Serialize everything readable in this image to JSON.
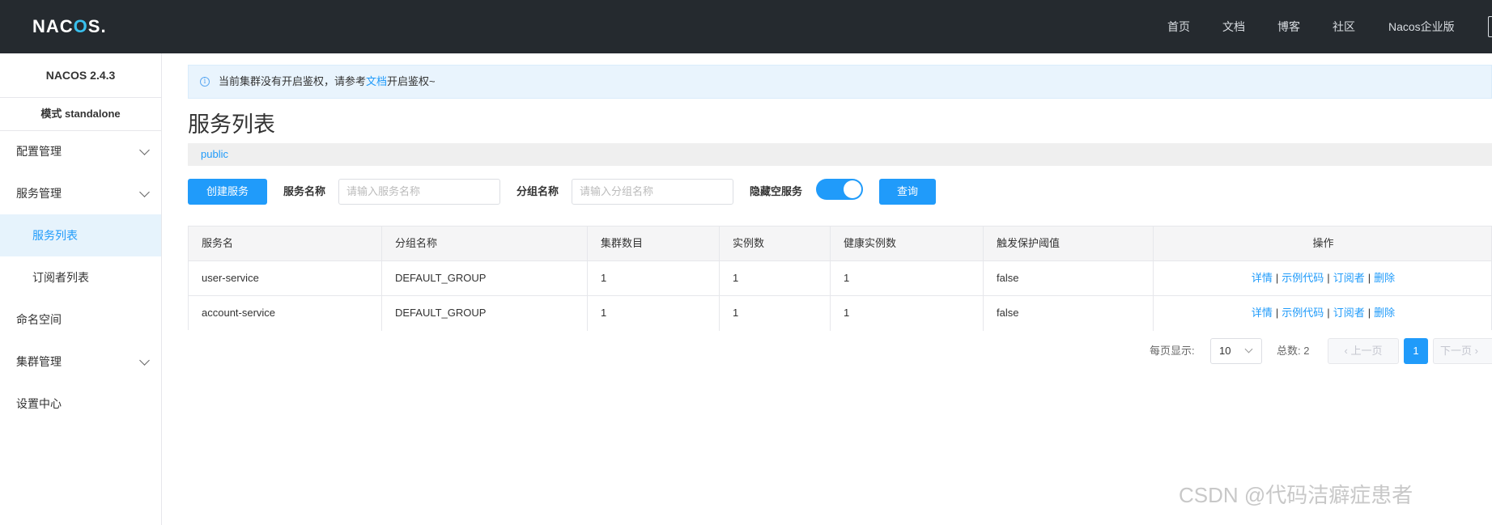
{
  "topbar": {
    "logo": {
      "prefix": "NAC",
      "o": "O",
      "suffix": "S."
    },
    "nav": [
      "首页",
      "文档",
      "博客",
      "社区",
      "Nacos企业版"
    ]
  },
  "sidebar": {
    "version": "NACOS 2.4.3",
    "mode": "模式 standalone",
    "items": [
      {
        "label": "配置管理",
        "expandable": true
      },
      {
        "label": "服务管理",
        "expandable": true
      },
      {
        "label": "服务列表",
        "active": true
      },
      {
        "label": "订阅者列表"
      },
      {
        "label": "命名空间"
      },
      {
        "label": "集群管理",
        "expandable": true
      },
      {
        "label": "设置中心"
      }
    ]
  },
  "notice": {
    "icon": "info-icon",
    "before": "当前集群没有开启鉴权，请参考",
    "link": "文档",
    "after": "开启鉴权~"
  },
  "page_title": "服务列表",
  "namespace": "public",
  "filters": {
    "create_button": "创建服务",
    "service_name_label": "服务名称",
    "service_name_placeholder": "请输入服务名称",
    "group_name_label": "分组名称",
    "group_name_placeholder": "请输入分组名称",
    "hide_empty_label": "隐藏空服务",
    "hide_empty_on": true,
    "query_button": "查询"
  },
  "table": {
    "headers": [
      "服务名",
      "分组名称",
      "集群数目",
      "实例数",
      "健康实例数",
      "触发保护阈值",
      "操作"
    ],
    "rows": [
      [
        "user-service",
        "DEFAULT_GROUP",
        "1",
        "1",
        "1",
        "false"
      ],
      [
        "account-service",
        "DEFAULT_GROUP",
        "1",
        "1",
        "1",
        "false"
      ]
    ],
    "actions": [
      "详情",
      "示例代码",
      "订阅者",
      "删除"
    ]
  },
  "pagination": {
    "per_page_label": "每页显示:",
    "per_page_value": "10",
    "total_label": "总数: 2",
    "prev": "上一页",
    "current": "1",
    "next": "下一页"
  },
  "watermark": "CSDN @代码洁癖症患者",
  "colors": {
    "accent": "#209bfa",
    "topbar": "#252a2f",
    "active_bg": "#e6f3fc"
  }
}
